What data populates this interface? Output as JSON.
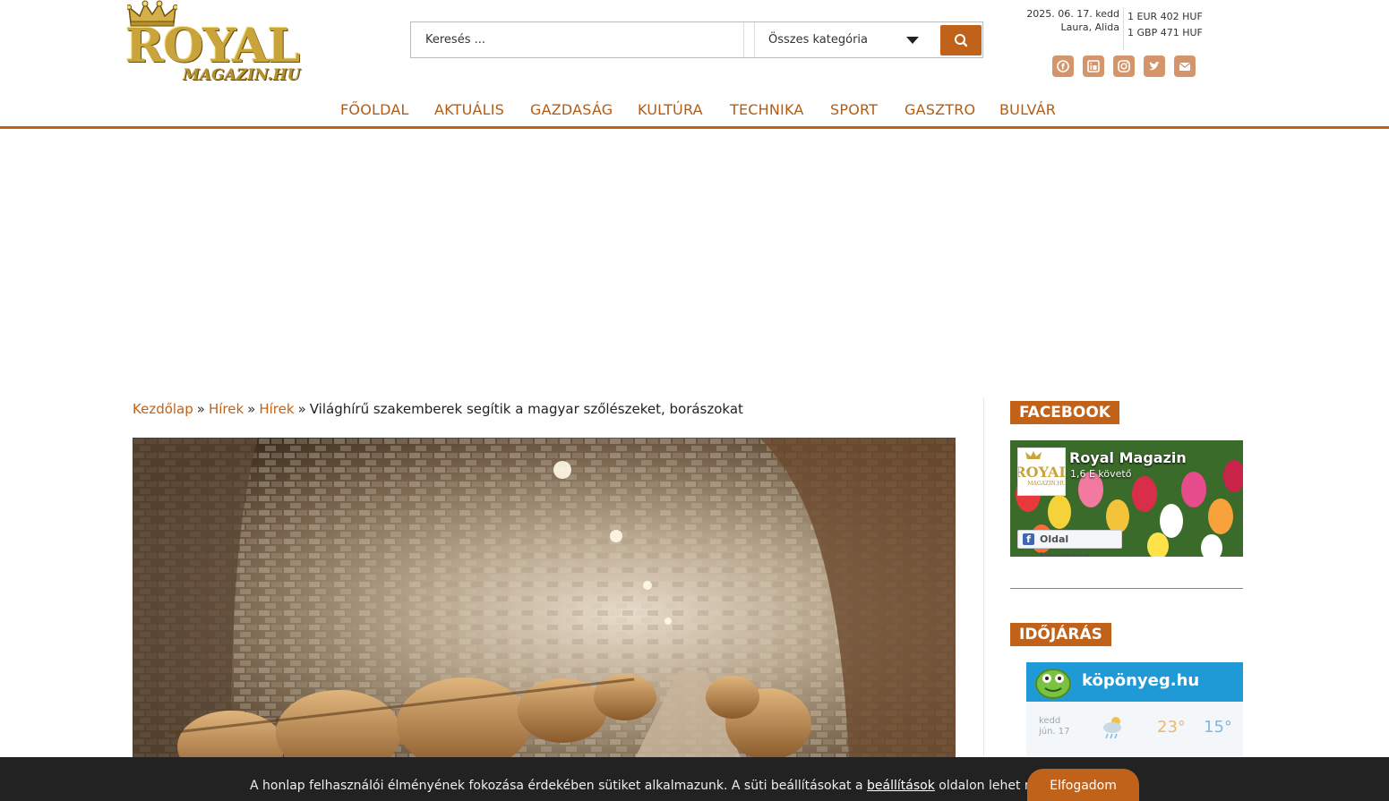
{
  "header": {
    "logo_royal": "ROYAL",
    "logo_magazin": "MAGAZIN.HU",
    "search_placeholder": "Keresés ...",
    "category_select": "Összes kategória",
    "date": "2025. 06. 17. kedd",
    "namedays": "Laura, Alida",
    "rates": [
      "1 EUR 402 HUF",
      "1 GBP 471 HUF"
    ],
    "socials": [
      "facebook-icon",
      "linkedin-icon",
      "instagram-icon",
      "twitter-icon",
      "email-icon"
    ]
  },
  "nav": {
    "items": [
      "FŐOLDAL",
      "AKTUÁLIS",
      "GAZDASÁG",
      "KULTÚRA",
      "TECHNIKA",
      "SPORT",
      "GASZTRO",
      "BULVÁR"
    ]
  },
  "breadcrumb": {
    "home": "Kezdőlap",
    "sep": "»",
    "level1": "Hírek",
    "level2": "Hírek",
    "current": "Világhírű szakemberek segítik a magyar szőlészeket, borászokat"
  },
  "sidebar": {
    "facebook_title": "FACEBOOK",
    "fb_page_name": "Royal Magazin",
    "fb_followers": "1,6 E követő",
    "fb_follow_button": "Oldal követése",
    "weather_title": "IDŐJÁRÁS",
    "weather_brand": "köpönyeg.hu",
    "weather_day": "kedd",
    "weather_date": "jún. 17",
    "weather_max": "23°",
    "weather_min": "15°"
  },
  "cookie": {
    "message_before": "A honlap felhasználói élményének fokozása érdekében sütiket alkalmazunk. A süti beállításokat a ",
    "link": "beállítások",
    "message_after": " oldalon lehet módosítani.",
    "accept": "Elfogadom"
  },
  "colors": {
    "accent": "#c0621a",
    "nav_text": "#b35c14",
    "cookie_bg": "#222222"
  }
}
